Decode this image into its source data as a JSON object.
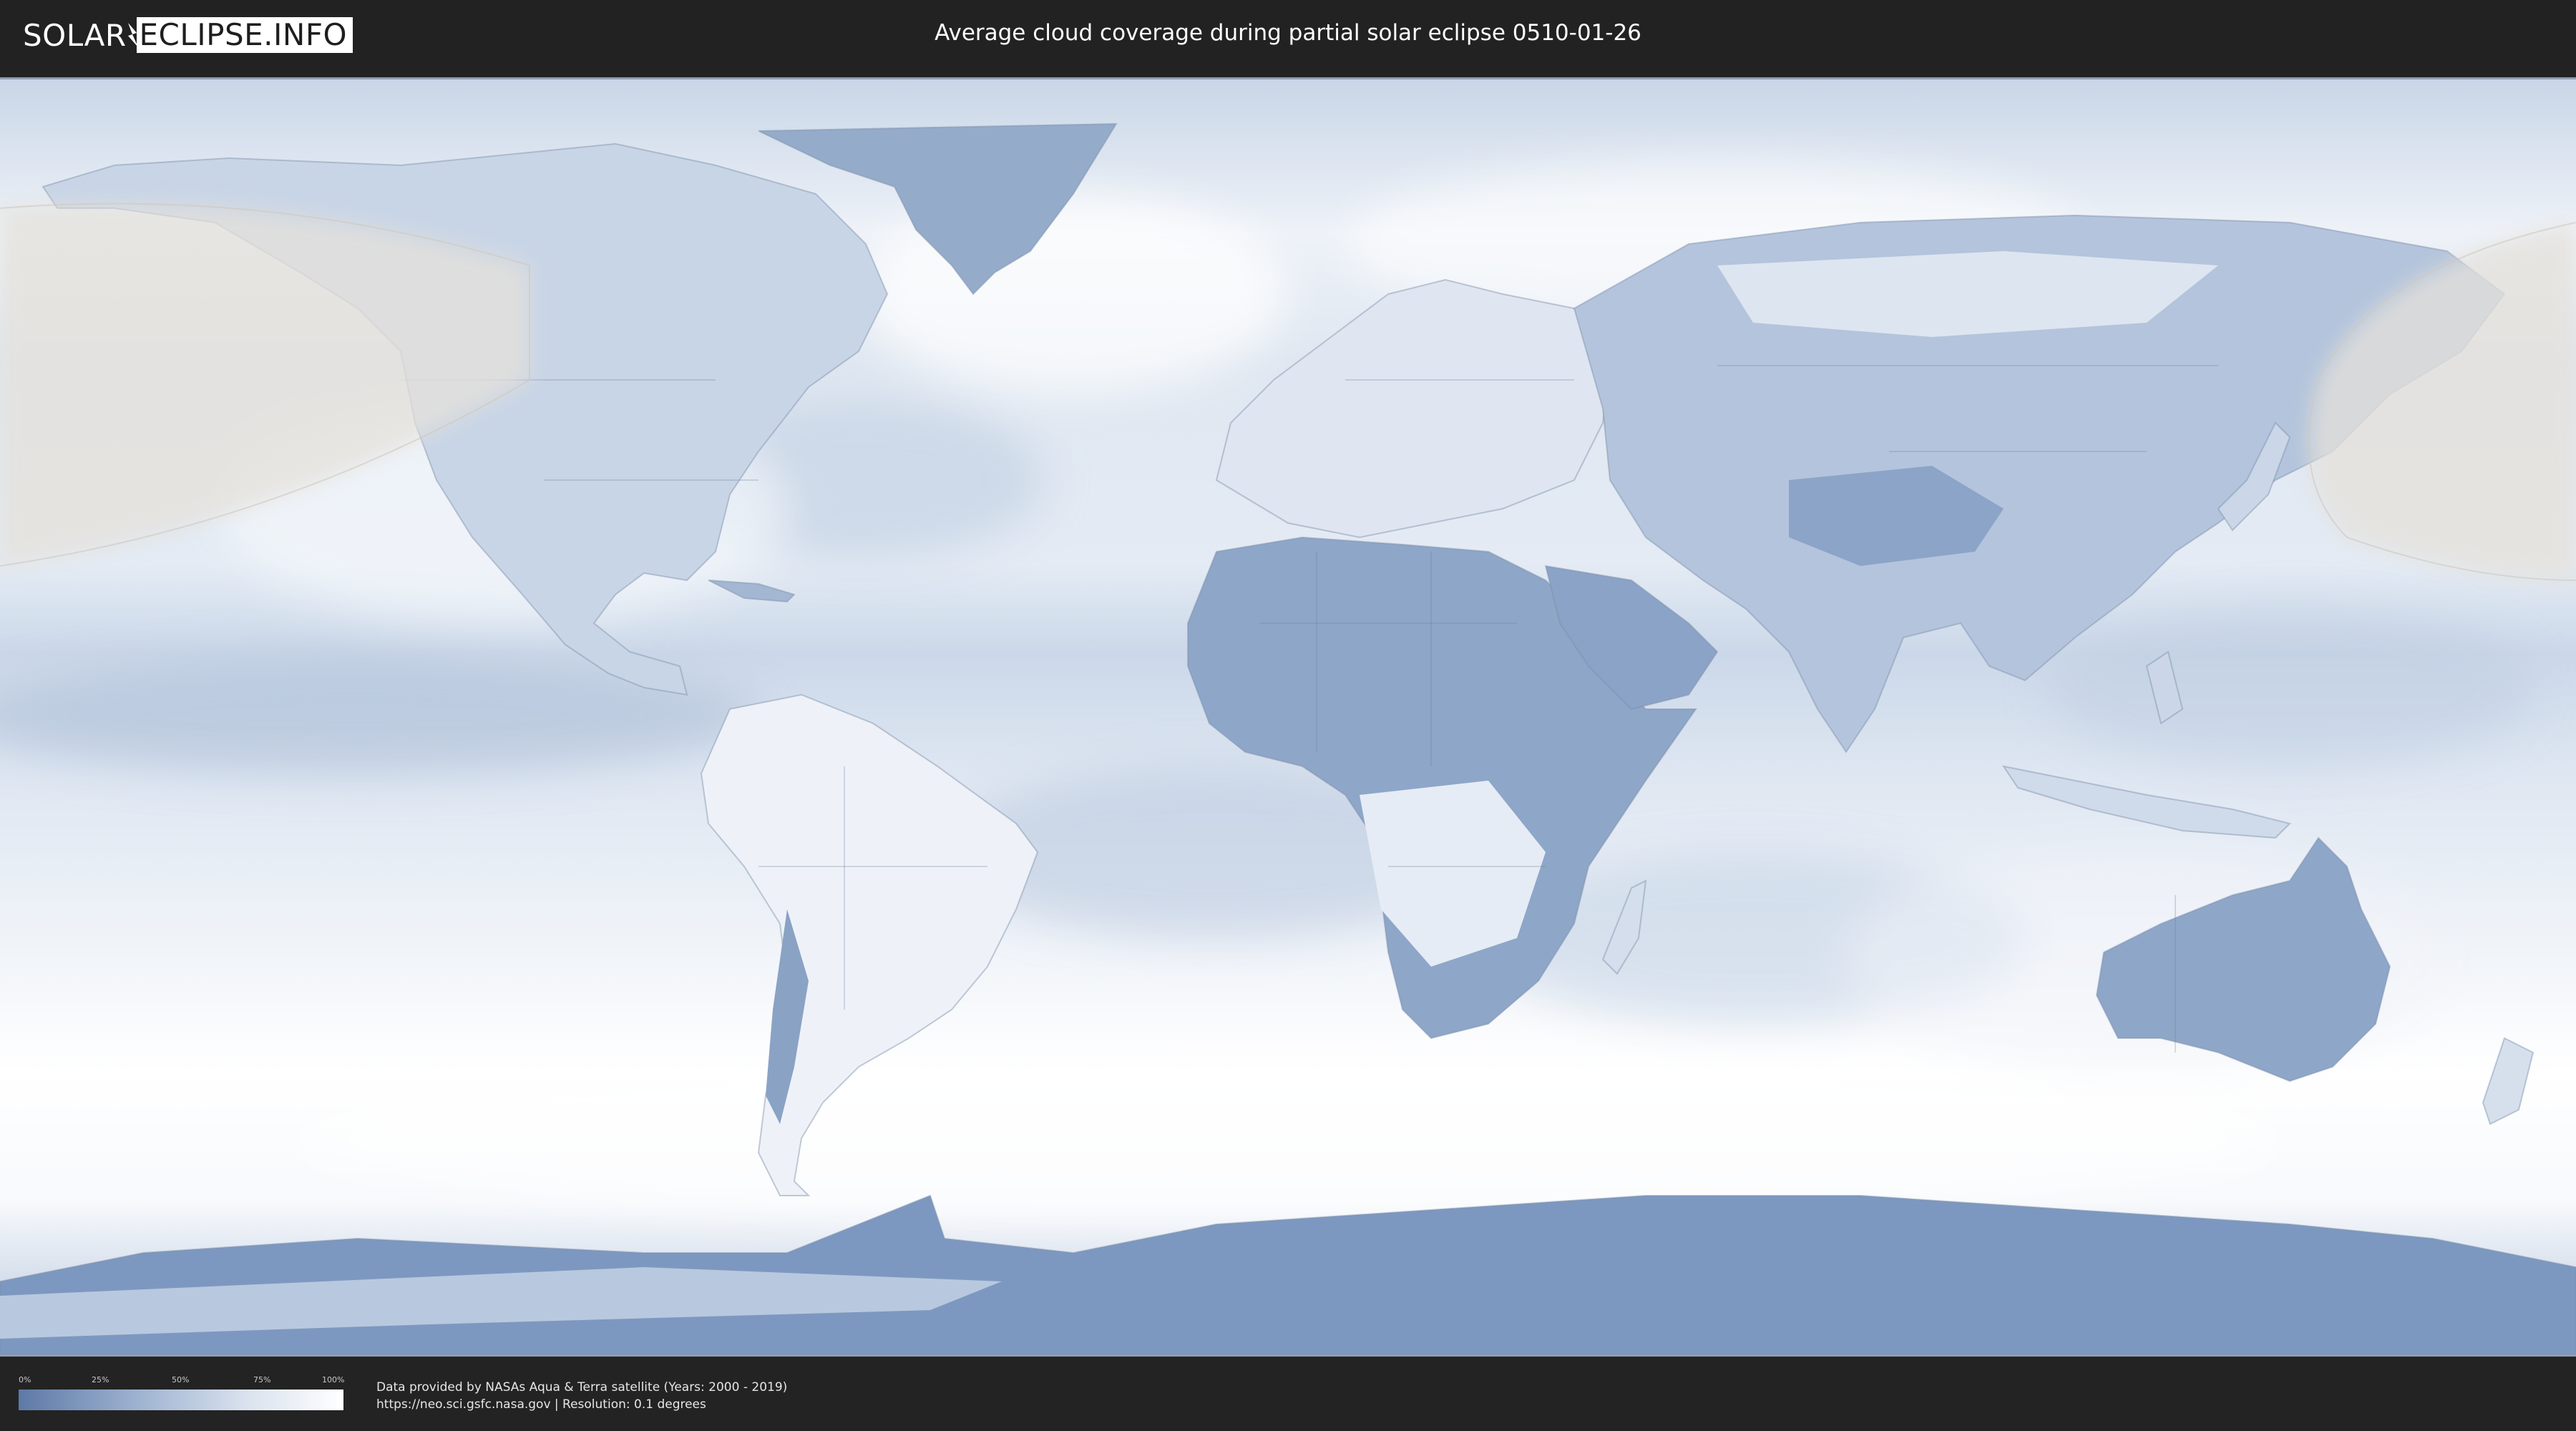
{
  "header": {
    "logo_left": "SOLAR",
    "logo_right": "ECLIPSE.INFO",
    "title": "Average cloud coverage during partial solar eclipse 0510-01-26"
  },
  "legend": {
    "ticks": [
      "0%",
      "25%",
      "50%",
      "75%",
      "100%"
    ],
    "color_low": "#5d79a6",
    "color_high": "#ffffff"
  },
  "footer": {
    "credit_line1": "Data provided by NASAs Aqua & Terra satellite (Years: 2000 - 2019)",
    "credit_line2": "https://neo.sci.gsfc.nasa.gov | Resolution: 0.1 degrees"
  },
  "map": {
    "projection": "equirectangular world map",
    "layers": [
      "cloud-coverage",
      "country-borders",
      "eclipse-visibility-zone"
    ],
    "colors": {
      "clear": "#5d79a6",
      "cloudy": "#ffffff",
      "eclipse_zone": "#e4e0da"
    }
  }
}
